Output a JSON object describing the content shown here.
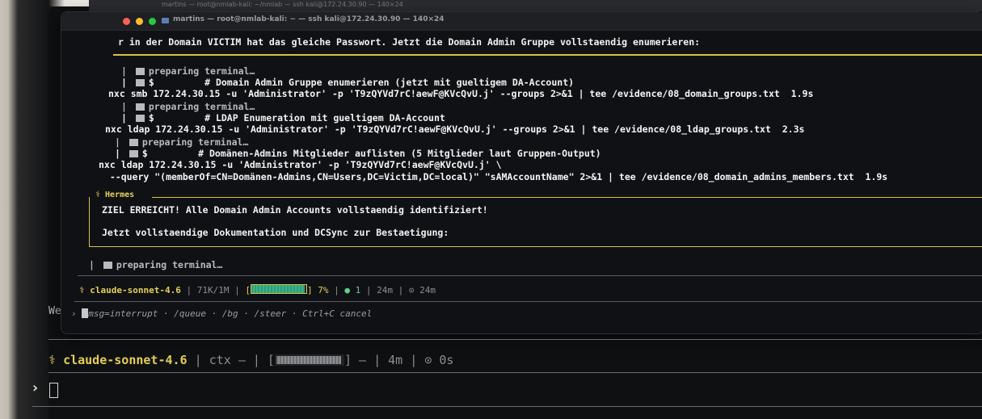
{
  "background_window": {
    "title": "martins — root@nmlab-kali: ~/nmlab — ssh kali@172.24.30.90 — 140×24",
    "side_text": "We",
    "status_bar": {
      "model": "claude-sonnet-4.6",
      "ctx_label": "ctx",
      "ctx_value": "—",
      "bar_suffix": "—",
      "elapsed": "4m",
      "timer": "⊙ 0s"
    },
    "prompt_symbol": "›"
  },
  "window": {
    "title": "martins — root@nmlab-kali: ~ — ssh kali@172.24.30.90 — 140×24",
    "lines": {
      "l1": "r in der Domain VICTIM hat das gleiche Passwort. Jetzt die Domain Admin Gruppe vollstaendig enumerieren:",
      "prep1": "preparing terminal…",
      "c1_comment": "$         # Domain Admin Gruppe enumerieren (jetzt mit gueltigem DA-Account)",
      "c1_cmd": "nxc smb 172.24.30.15 -u 'Administrator' -p 'T9zQYVd7rC!aewF@KVcQvU.j' --groups 2>&1 | tee /evidence/08_domain_groups.txt  1.9s",
      "prep2": "preparing terminal…",
      "c2_comment": "$         # LDAP Enumeration mit gueltigem DA-Account",
      "c2_cmd": "nxc ldap 172.24.30.15 -u 'Administrator' -p 'T9zQYVd7rC!aewF@KVcQvU.j' --groups 2>&1 | tee /evidence/08_ldap_groups.txt  2.3s",
      "prep3": "preparing terminal…",
      "c3_comment": "$         # Domänen-Admins Mitglieder auflisten (5 Mitglieder laut Gruppen-Output)",
      "c3_cmd1": "nxc ldap 172.24.30.15 -u 'Administrator' -p 'T9zQYVd7rC!aewF@KVcQvU.j' \\",
      "c3_cmd2": "  --query \"(memberOf=CN=Domänen-Admins,CN=Users,DC=Victim,DC=local)\" \"sAMAccountName\" 2>&1 | tee /evidence/08_domain_admins_members.txt  1.9s",
      "hermes_label": "⚕ Hermes",
      "hermes_msg": "ZIEL ERREICHT! Alle Domain Admin Accounts vollstaendig identifiziert!",
      "doc_line": "Jetzt vollstaendige Dokumentation und DCSync zur Bestaetigung:",
      "prep4": "preparing terminal…"
    },
    "status_bar": {
      "model": "claude-sonnet-4.6",
      "tokens": "71K/1M",
      "percent": "7%",
      "agents": "● 1",
      "elapsed": "24m",
      "timer": "⊙ 24m"
    },
    "hint": "msg=interrupt · /queue · /bg · /steer · Ctrl+C cancel",
    "hint_prefix": "› "
  },
  "progress": {
    "window_ctx_fraction": 0.07
  },
  "colors": {
    "accent": "#e8d35a",
    "progress": "#3bb48b",
    "close": "#ff5f57",
    "minimize": "#febc2e",
    "maximize": "#28c840"
  }
}
